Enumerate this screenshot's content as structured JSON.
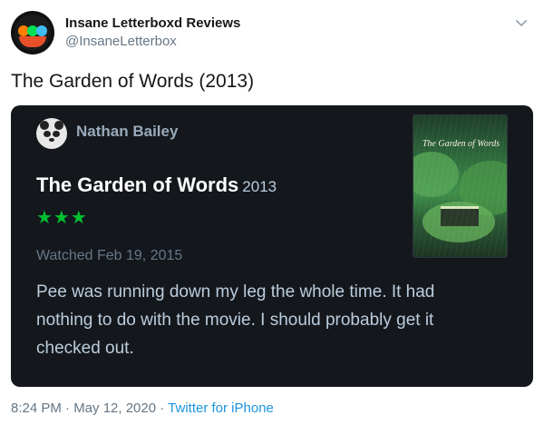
{
  "header": {
    "display_name": "Insane Letterboxd Reviews",
    "handle": "@InsaneLetterbox",
    "avatar_icon": "letterboxd-flame-logo",
    "menu_icon": "chevron-down-icon"
  },
  "tweet": {
    "text": "The Garden of Words (2013)"
  },
  "review_card": {
    "reviewer_name": "Nathan Bailey",
    "reviewer_avatar_icon": "panda-avatar",
    "film_title": "The Garden of Words",
    "film_year": "2013",
    "rating_stars": "★★★",
    "rating_value": 3,
    "watched_date": "Watched Feb 19, 2015",
    "review_text": "Pee was running down my leg the whole time. It had nothing to do with the movie. I should probably get it checked out.",
    "poster_title": "The Garden of Words",
    "colors": {
      "background": "#14181c",
      "stars": "#00c030",
      "reviewer_name": "#99aabb"
    }
  },
  "footer": {
    "timestamp": "8:24 PM · May 12, 2020 · ",
    "source": "Twitter for iPhone",
    "source_color": "#1b95e0"
  }
}
